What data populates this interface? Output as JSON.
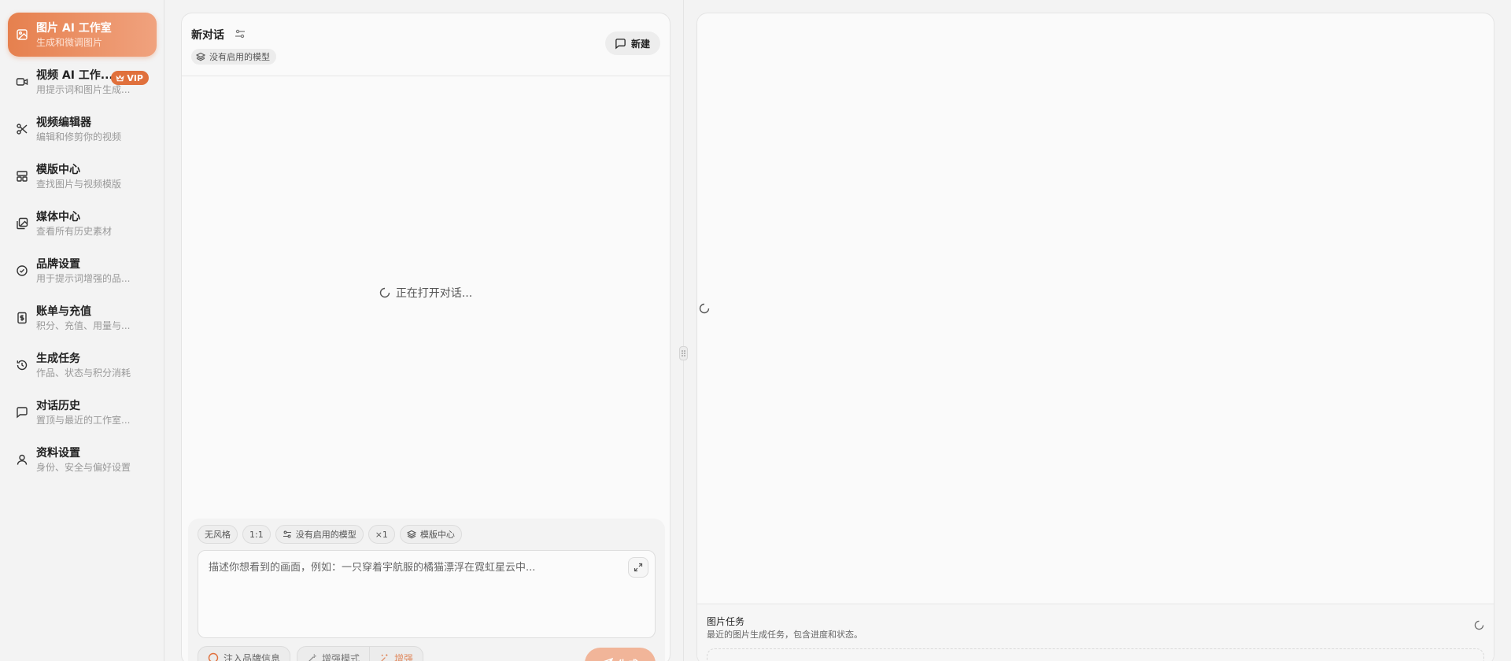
{
  "sidebar": {
    "items": [
      {
        "title": "图片 AI 工作室",
        "subtitle": "生成和微调图片",
        "icon": "image-icon",
        "active": true
      },
      {
        "title": "视频 AI 工作...",
        "subtitle": "用提示词和图片生成...",
        "icon": "video-camera-icon",
        "badge": "VIP"
      },
      {
        "title": "视频编辑器",
        "subtitle": "编辑和修剪你的视频",
        "icon": "scissors-icon"
      },
      {
        "title": "模版中心",
        "subtitle": "查找图片与视频模版",
        "icon": "layout-template-icon"
      },
      {
        "title": "媒体中心",
        "subtitle": "查看所有历史素材",
        "icon": "images-icon"
      },
      {
        "title": "品牌设置",
        "subtitle": "用于提示词增强的品...",
        "icon": "badge-check-icon"
      },
      {
        "title": "账单与充值",
        "subtitle": "积分、充值、用量与...",
        "icon": "receipt-dollar-icon"
      },
      {
        "title": "生成任务",
        "subtitle": "作品、状态与积分消耗",
        "icon": "history-icon"
      },
      {
        "title": "对话历史",
        "subtitle": "置顶与最近的工作室...",
        "icon": "message-square-icon"
      },
      {
        "title": "资料设置",
        "subtitle": "身份、安全与偏好设置",
        "icon": "user-icon"
      }
    ]
  },
  "chat": {
    "title": "新对话",
    "model_chip": "没有启用的模型",
    "new_button": "新建",
    "loading_text": "正在打开对话..."
  },
  "composer": {
    "pills": {
      "style": "无风格",
      "ratio": "1:1",
      "model": "没有启用的模型",
      "count": "×1",
      "templates": "模版中心"
    },
    "placeholder": "描述你想看到的画面，例如：一只穿着宇航服的橘猫漂浮在霓虹星云中...",
    "brand_button": "注入品牌信息",
    "enhance_mode": "增强模式",
    "enhance": "增强",
    "send_button": "生成"
  },
  "tasks": {
    "title": "图片任务",
    "subtitle": "最近的图片生成任务，包含进度和状态。"
  },
  "colors": {
    "accent": "#e6804e",
    "accent_light": "#f0a27e",
    "vip": "#e0703c",
    "background": "#f3f3f3",
    "panel": "#fafafa"
  }
}
